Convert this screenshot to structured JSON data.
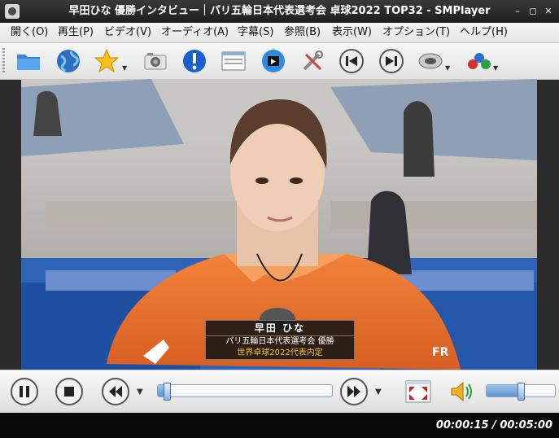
{
  "window": {
    "title": "早田ひな 優勝インタビュー｜パリ五輪日本代表選考会 卓球2022 TOP32 - SMPlayer",
    "minimize_glyph": "–",
    "maximize_glyph": "◻",
    "close_glyph": "✕"
  },
  "menu": {
    "items": [
      {
        "label": "開く(O)"
      },
      {
        "label": "再生(P)"
      },
      {
        "label": "ビデオ(V)"
      },
      {
        "label": "オーディオ(A)"
      },
      {
        "label": "字幕(S)"
      },
      {
        "label": "参照(B)"
      },
      {
        "label": "表示(W)"
      },
      {
        "label": "オプション(T)"
      },
      {
        "label": "ヘルプ(H)"
      }
    ]
  },
  "toolbar": {
    "icons": [
      "folder-icon",
      "globe-icon",
      "star-icon",
      "camera-icon",
      "info-icon",
      "playlist-icon",
      "video-clip-icon",
      "tools-icon",
      "previous-icon",
      "next-icon",
      "audio-icon",
      "subtitle-icon"
    ],
    "dropdown_glyph": "▼"
  },
  "video": {
    "caption_name": "早田 ひな",
    "caption_line1": "パリ五輪日本代表選考会 優勝",
    "caption_line2": "世界卓球2022代表内定"
  },
  "controls": {
    "dropdown_glyph": "▼",
    "progress_fraction": 0.05,
    "volume_fraction": 0.5
  },
  "status": {
    "time": "00:00:15 / 00:05:00"
  },
  "colors": {
    "accent_blue": "#5f95cf",
    "title_bar": "#262626",
    "status_bar": "#0a0a0a",
    "caption_yellow": "#f0c030"
  }
}
